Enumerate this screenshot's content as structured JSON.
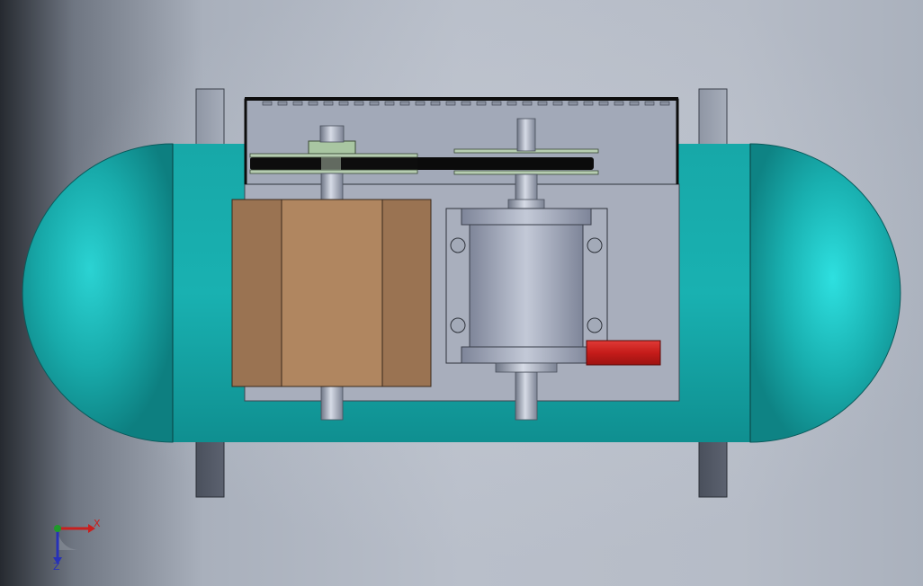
{
  "app": {
    "title": "",
    "view": "cad-3d-viewport"
  },
  "model": {
    "parts": [
      "tank-body",
      "tank-end-cap-left",
      "tank-end-cap-right",
      "support-leg",
      "mounting-plate",
      "belt-guard",
      "drive-belt",
      "motor-pulley",
      "compressor-pulley",
      "shaft",
      "motor-block",
      "compressor-cylinder",
      "compressor-bracket",
      "pressure-switch"
    ],
    "colors": {
      "tank": "#17a3a3",
      "tank_highlight": "#2ad6d6",
      "steel": "#9ea6b8",
      "motor": "#b08660",
      "motor_dark": "#9a7352",
      "pulley_green": "#a9c6a2",
      "belt": "#0b0b0b",
      "red_part": "#c8201e"
    }
  },
  "triad": {
    "x_label": "X",
    "z_label": "Z",
    "x_color": "#c8201e",
    "y_color": "#1f9a2a",
    "z_color": "#2732b8"
  }
}
